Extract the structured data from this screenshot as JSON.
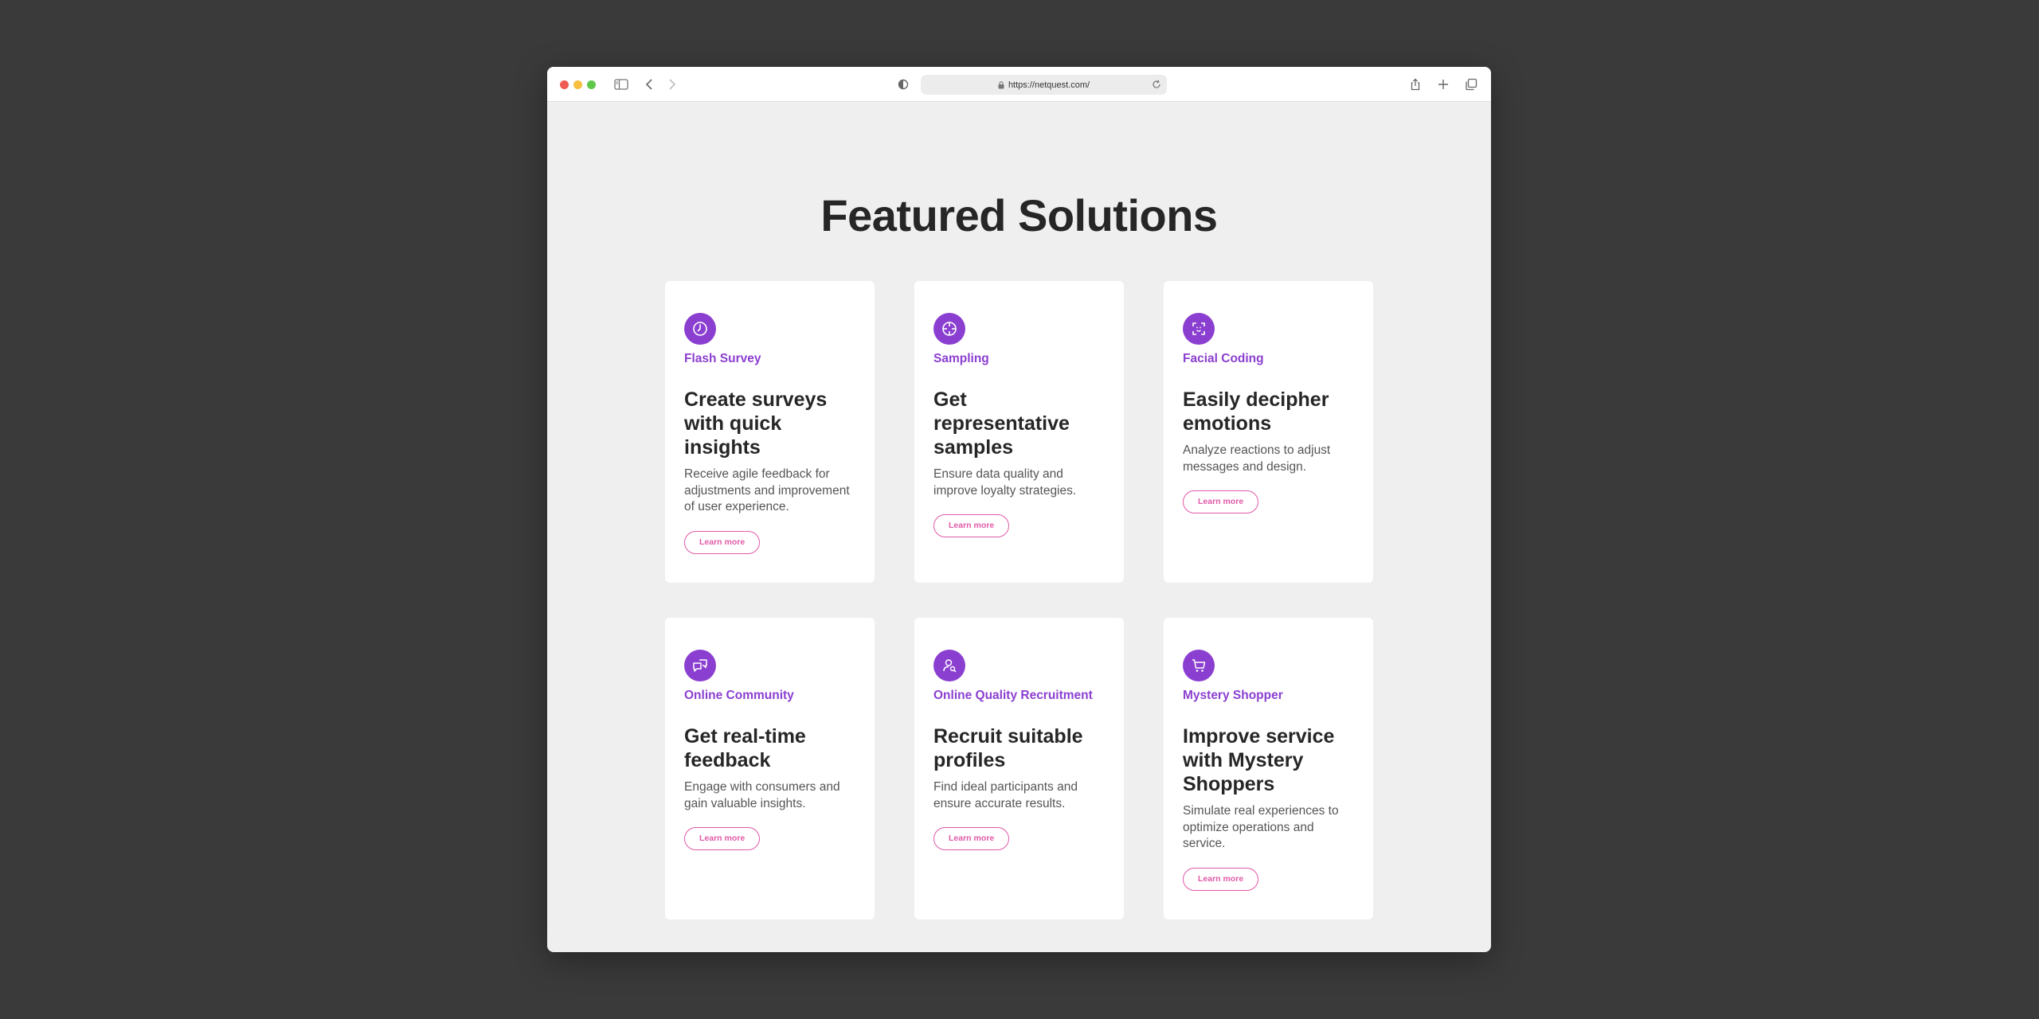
{
  "browser": {
    "url": "https://netquest.com/"
  },
  "page": {
    "headline": "Featured Solutions"
  },
  "cards": [
    {
      "icon": "clock-icon",
      "label": "Flash Survey",
      "title": "Create surveys with quick insights",
      "description": "Receive agile feedback for adjustments and improvement of user experience.",
      "button": "Learn more"
    },
    {
      "icon": "target-icon",
      "label": "Sampling",
      "title": "Get representative samples",
      "description": "Ensure data quality and improve loyalty strategies.",
      "button": "Learn more"
    },
    {
      "icon": "face-scan-icon",
      "label": "Facial Coding",
      "title": "Easily decipher emotions",
      "description": "Analyze reactions to adjust messages and design.",
      "button": "Learn more"
    },
    {
      "icon": "chat-bubbles-icon",
      "label": "Online Community",
      "title": "Get real-time feedback",
      "description": "Engage with consumers and gain valuable insights.",
      "button": "Learn more"
    },
    {
      "icon": "user-search-icon",
      "label": "Online Quality Recruitment",
      "title": "Recruit suitable profiles",
      "description": "Find ideal participants and ensure accurate results.",
      "button": "Learn more"
    },
    {
      "icon": "cart-icon",
      "label": "Mystery Shopper",
      "title": "Improve service with Mystery Shoppers",
      "description": "Simulate real experiences to optimize operations and service.",
      "button": "Learn more"
    }
  ],
  "colors": {
    "accent_purple": "#8b3fd0",
    "button_pink": "#e05aa8",
    "page_background": "#efefef",
    "desktop_background": "#3a3a3a"
  }
}
